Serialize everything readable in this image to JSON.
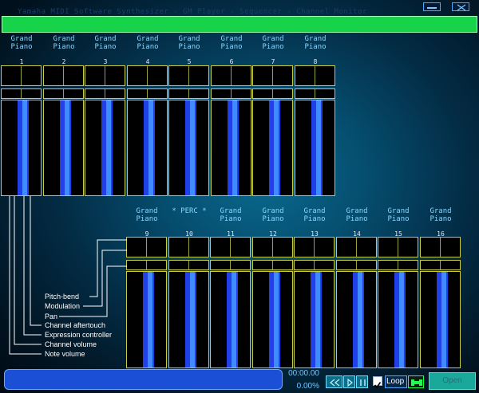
{
  "window": {
    "title": "Yamaha MIDI Software Synthesizer - GM Player - Sequencer - Channel Monitor"
  },
  "channels_top": [
    {
      "num": "1",
      "inst1": "Grand",
      "inst2": "Piano"
    },
    {
      "num": "2",
      "inst1": "Grand",
      "inst2": "Piano"
    },
    {
      "num": "3",
      "inst1": "Grand",
      "inst2": "Piano"
    },
    {
      "num": "4",
      "inst1": "Grand",
      "inst2": "Piano"
    },
    {
      "num": "5",
      "inst1": "Grand",
      "inst2": "Piano"
    },
    {
      "num": "6",
      "inst1": "Grand",
      "inst2": "Piano"
    },
    {
      "num": "7",
      "inst1": "Grand",
      "inst2": "Piano"
    },
    {
      "num": "8",
      "inst1": "Grand",
      "inst2": "Piano"
    }
  ],
  "channels_bottom": [
    {
      "num": "9",
      "inst1": "Grand",
      "inst2": "Piano"
    },
    {
      "num": "10",
      "inst1": "* PERC *",
      "inst2": ""
    },
    {
      "num": "11",
      "inst1": "Grand",
      "inst2": "Piano"
    },
    {
      "num": "12",
      "inst1": "Grand",
      "inst2": "Piano"
    },
    {
      "num": "13",
      "inst1": "Grand",
      "inst2": "Piano"
    },
    {
      "num": "14",
      "inst1": "Grand",
      "inst2": "Piano"
    },
    {
      "num": "15",
      "inst1": "Grand",
      "inst2": "Piano"
    },
    {
      "num": "16",
      "inst1": "Grand",
      "inst2": "Piano"
    }
  ],
  "legend": {
    "pitch_bend": "Pitch-bend",
    "modulation": "Modulation",
    "pan": "Pan",
    "channel_aftertouch": "Channel aftertouch",
    "expression": "Expression controller",
    "channel_volume": "Channel volume",
    "note_volume": "Note volume"
  },
  "transport": {
    "time": "00:00.00",
    "percent": "0.00%",
    "loop_label": "Loop",
    "loop_checked": true,
    "open_label": "Open"
  },
  "colors": {
    "accent_green": "#17d34a",
    "meter_blue": "#2240e8",
    "frame_yellow": "#c8cc44"
  }
}
